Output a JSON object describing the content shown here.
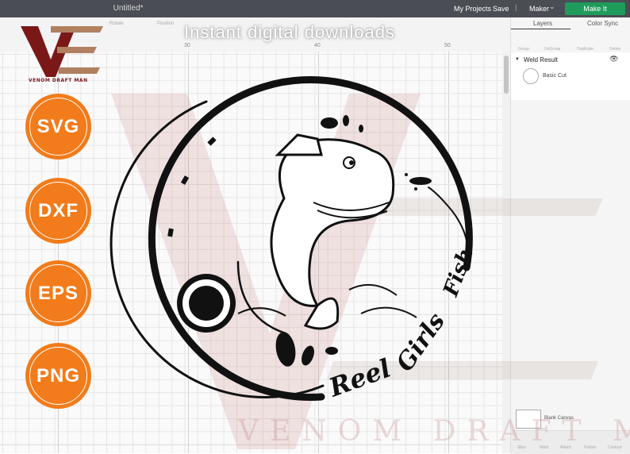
{
  "window": {
    "title": "Untitled*"
  },
  "topbar": {
    "my_projects": "My Projects",
    "save": "Save",
    "separator": "|",
    "machine": "Maker",
    "make_it": "Make It",
    "make_it_color": "#1f9c5c"
  },
  "subtoolbar": {
    "rotate_label": "Rotate",
    "position_label": "Position"
  },
  "ruler": {
    "marks": [
      "30",
      "40",
      "50"
    ]
  },
  "panel": {
    "tabs": [
      "Layers",
      "Color Sync"
    ],
    "tools": [
      "Group",
      "UnGroup",
      "Duplicate",
      "Delete"
    ],
    "layer_group": "Weld Result",
    "layer_item": "Basic Cut",
    "canvas_label": "Blank Canvas",
    "bottom_tools": [
      "Slice",
      "Weld",
      "Attach",
      "Flatten",
      "Contour"
    ]
  },
  "overlay": {
    "banner": "Instant digital downloads",
    "formats": [
      "SVG",
      "DXF",
      "EPS",
      "PNG"
    ],
    "format_color": "#f27b1b",
    "brand_text": "VENOM DRAFT MAN",
    "watermark_text": "VENOM DRAFT MAN",
    "brand_color": "#7a1818"
  },
  "design": {
    "script_words": [
      "Reel",
      "Girls",
      "Fish"
    ]
  }
}
